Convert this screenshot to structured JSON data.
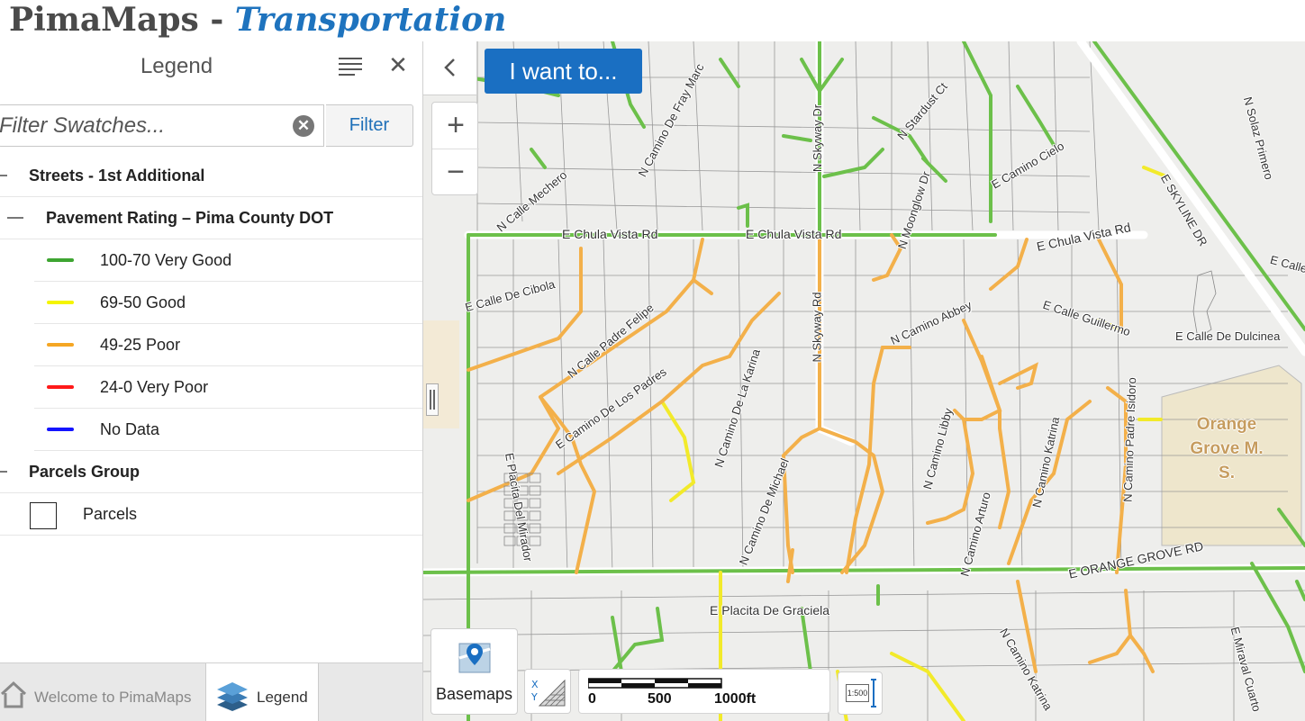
{
  "header": {
    "title_main": "PimaMaps",
    "title_sep": " - ",
    "title_sub": "Transportation"
  },
  "panel": {
    "title": "Legend",
    "filter": {
      "placeholder": "Filter Swatches...",
      "button": "Filter"
    }
  },
  "legend": {
    "streets_group": "Streets - 1st Additional",
    "pavement_layer": "Pavement Rating – Pima County DOT",
    "items": [
      {
        "label": "100-70 Very Good",
        "color": "#3ea531"
      },
      {
        "label": "69-50 Good",
        "color": "#f5f500"
      },
      {
        "label": "49-25 Poor",
        "color": "#f5a623"
      },
      {
        "label": "24-0 Very Poor",
        "color": "#ff1a1a"
      },
      {
        "label": "No Data",
        "color": "#1414ff"
      }
    ],
    "parcels_group": "Parcels Group",
    "parcels_layer": "Parcels"
  },
  "tabs": [
    {
      "label": "Welcome to PimaMaps",
      "icon": "home-icon"
    },
    {
      "label": "Legend",
      "icon": "layers-icon"
    }
  ],
  "map": {
    "iwant_label": "I want to...",
    "basemaps_label": "Basemaps",
    "scale_labels": [
      "0",
      "500",
      "1000ft"
    ],
    "scale_badge": "1:500",
    "street_labels": [
      "E Chula Vista Rd",
      "E Chula Vista Rd",
      "E Chula Vista Rd",
      "N Calle Mechero",
      "N Camino De Fray Marc",
      "N Skyway Dr",
      "N Stardust Ct",
      "N Moonglow Dr",
      "E Camino Cielo",
      "E SKYLINE DR",
      "E Calle De Cibola",
      "N Calle Padre Felipe",
      "N Camino De La Karina",
      "N Skyway Rd",
      "N Camino Abbey",
      "E Calle Guillermo",
      "E Calle De Dulcinea",
      "E Camino De Los Padres",
      "N Camino De Michael",
      "N Camino Libby",
      "N Camino Arturo",
      "N Camino Katrina",
      "N Camino Padre Isidoro",
      "E ORANGE GROVE RD",
      "E Placita De Graciela",
      "N Camino Katrina",
      "E Miraval Cuarto",
      "N Solaz Primero",
      "E Calle",
      "E Placita Del Mirador"
    ],
    "school_label": "Orange Grove M. S."
  }
}
